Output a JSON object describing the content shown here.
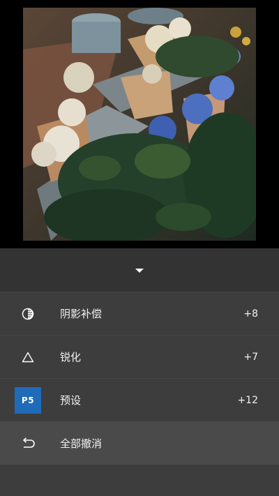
{
  "panel": {
    "collapse_icon": "triangle-down-icon",
    "items": [
      {
        "icon": "shadow-compensation-icon",
        "label": "阴影补偿",
        "value": "+8"
      },
      {
        "icon": "triangle-outline-icon",
        "label": "锐化",
        "value": "+7"
      },
      {
        "icon": "preset-badge",
        "badge_text": "P5",
        "label": "预设",
        "value": "+12"
      },
      {
        "icon": "undo-icon",
        "label": "全部撤消",
        "value": ""
      }
    ]
  },
  "colors": {
    "panel_bg": "#3d3d3d",
    "header_bg": "#333333",
    "selected_row_bg": "#4a4a4a",
    "preset_badge": "#1f6bb8"
  }
}
